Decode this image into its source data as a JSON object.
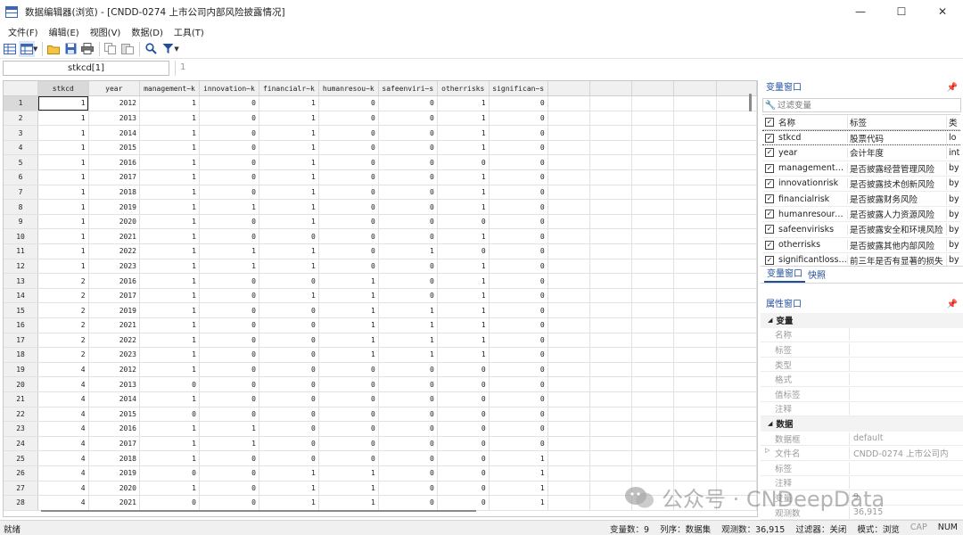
{
  "window": {
    "title": "数据编辑器(浏览) - [CNDD-0274 上市公司内部风险披露情况]",
    "controls": [
      "—",
      "☐",
      "✕"
    ]
  },
  "menu": [
    "文件(F)",
    "编辑(E)",
    "视图(V)",
    "数据(D)",
    "工具(T)"
  ],
  "toolbar": {
    "icons": [
      "data-editor-icon",
      "table-view-icon",
      "open-icon",
      "save-icon",
      "print-icon",
      "copy-icon",
      "paste-icon",
      "search-icon",
      "filter-icon"
    ]
  },
  "refbar": {
    "cell_ref": "stkcd[1]",
    "cell_value": "1"
  },
  "grid": {
    "columns": [
      "stkcd",
      "year",
      "management~k",
      "innovation~k",
      "financialr~k",
      "humanresou~k",
      "safeenviri~s",
      "otherrisks",
      "significan~s"
    ],
    "rows": [
      [
        "1",
        "1",
        "2012",
        "1",
        "0",
        "1",
        "0",
        "0",
        "1",
        "0"
      ],
      [
        "2",
        "1",
        "2013",
        "1",
        "0",
        "1",
        "0",
        "0",
        "1",
        "0"
      ],
      [
        "3",
        "1",
        "2014",
        "1",
        "0",
        "1",
        "0",
        "0",
        "1",
        "0"
      ],
      [
        "4",
        "1",
        "2015",
        "1",
        "0",
        "1",
        "0",
        "0",
        "1",
        "0"
      ],
      [
        "5",
        "1",
        "2016",
        "1",
        "0",
        "1",
        "0",
        "0",
        "0",
        "0"
      ],
      [
        "6",
        "1",
        "2017",
        "1",
        "0",
        "1",
        "0",
        "0",
        "1",
        "0"
      ],
      [
        "7",
        "1",
        "2018",
        "1",
        "0",
        "1",
        "0",
        "0",
        "1",
        "0"
      ],
      [
        "8",
        "1",
        "2019",
        "1",
        "1",
        "1",
        "0",
        "0",
        "1",
        "0"
      ],
      [
        "9",
        "1",
        "2020",
        "1",
        "0",
        "1",
        "0",
        "0",
        "0",
        "0"
      ],
      [
        "10",
        "1",
        "2021",
        "1",
        "0",
        "0",
        "0",
        "0",
        "1",
        "0"
      ],
      [
        "11",
        "1",
        "2022",
        "1",
        "1",
        "1",
        "0",
        "1",
        "0",
        "0"
      ],
      [
        "12",
        "1",
        "2023",
        "1",
        "1",
        "1",
        "0",
        "0",
        "1",
        "0"
      ],
      [
        "13",
        "2",
        "2016",
        "1",
        "0",
        "0",
        "1",
        "0",
        "1",
        "0"
      ],
      [
        "14",
        "2",
        "2017",
        "1",
        "0",
        "1",
        "1",
        "0",
        "1",
        "0"
      ],
      [
        "15",
        "2",
        "2019",
        "1",
        "0",
        "0",
        "1",
        "1",
        "1",
        "0"
      ],
      [
        "16",
        "2",
        "2021",
        "1",
        "0",
        "0",
        "1",
        "1",
        "1",
        "0"
      ],
      [
        "17",
        "2",
        "2022",
        "1",
        "0",
        "0",
        "1",
        "1",
        "1",
        "0"
      ],
      [
        "18",
        "2",
        "2023",
        "1",
        "0",
        "0",
        "1",
        "1",
        "1",
        "0"
      ],
      [
        "19",
        "4",
        "2012",
        "1",
        "0",
        "0",
        "0",
        "0",
        "0",
        "0"
      ],
      [
        "20",
        "4",
        "2013",
        "0",
        "0",
        "0",
        "0",
        "0",
        "0",
        "0"
      ],
      [
        "21",
        "4",
        "2014",
        "1",
        "0",
        "0",
        "0",
        "0",
        "0",
        "0"
      ],
      [
        "22",
        "4",
        "2015",
        "0",
        "0",
        "0",
        "0",
        "0",
        "0",
        "0"
      ],
      [
        "23",
        "4",
        "2016",
        "1",
        "1",
        "0",
        "0",
        "0",
        "0",
        "0"
      ],
      [
        "24",
        "4",
        "2017",
        "1",
        "1",
        "0",
        "0",
        "0",
        "0",
        "0"
      ],
      [
        "25",
        "4",
        "2018",
        "1",
        "0",
        "0",
        "0",
        "0",
        "0",
        "1"
      ],
      [
        "26",
        "4",
        "2019",
        "0",
        "0",
        "1",
        "1",
        "0",
        "0",
        "1"
      ],
      [
        "27",
        "4",
        "2020",
        "1",
        "0",
        "1",
        "1",
        "0",
        "0",
        "1"
      ],
      [
        "28",
        "4",
        "2021",
        "0",
        "0",
        "1",
        "1",
        "0",
        "0",
        "1"
      ]
    ]
  },
  "variables_panel": {
    "title": "变量窗口",
    "filter_placeholder": "过滤变量",
    "headers": {
      "name": "名称",
      "label": "标签",
      "type": "类"
    },
    "items": [
      {
        "name": "stkcd",
        "label": "股票代码",
        "type": "lo"
      },
      {
        "name": "year",
        "label": "会计年度",
        "type": "int"
      },
      {
        "name": "managementri...",
        "label": "是否披露经营管理风险",
        "type": "by"
      },
      {
        "name": "innovationrisk",
        "label": "是否披露技术创新风险",
        "type": "by"
      },
      {
        "name": "financialrisk",
        "label": "是否披露财务风险",
        "type": "by"
      },
      {
        "name": "humanresourc...",
        "label": "是否披露人力资源风险",
        "type": "by"
      },
      {
        "name": "safeenvirisks",
        "label": "是否披露安全和环境风险",
        "type": "by"
      },
      {
        "name": "otherrisks",
        "label": "是否披露其他内部风险",
        "type": "by"
      },
      {
        "name": "significantlosses",
        "label": "前三年是否有显著的损失",
        "type": "by"
      }
    ],
    "tabs": [
      "变量窗口",
      "快照"
    ]
  },
  "properties_panel": {
    "title": "属性窗口",
    "sections": [
      {
        "name": "变量",
        "rows": [
          {
            "key": "名称",
            "value": ""
          },
          {
            "key": "标签",
            "value": ""
          },
          {
            "key": "类型",
            "value": ""
          },
          {
            "key": "格式",
            "value": ""
          },
          {
            "key": "值标签",
            "value": ""
          },
          {
            "key": "注释",
            "value": ""
          }
        ]
      },
      {
        "name": "数据",
        "rows": [
          {
            "key": "数据框",
            "value": "default"
          },
          {
            "key": "文件名",
            "value": "CNDD-0274 上市公司内"
          },
          {
            "key": "标签",
            "value": ""
          },
          {
            "key": "注释",
            "value": ""
          },
          {
            "key": "变量",
            "value": "9"
          },
          {
            "key": "观测数",
            "value": "36,915"
          }
        ]
      }
    ]
  },
  "status": {
    "left": "就绪",
    "vars": "变量数：9",
    "order": "列序：数据集",
    "obs": "观测数：36,915",
    "filter": "过滤器：关闭",
    "mode": "模式：浏览",
    "cap": "CAP",
    "num": "NUM"
  },
  "watermark": {
    "text": "公众号 · CNDeepData"
  },
  "colors": {
    "accent": "#1f4e9c",
    "header_bg": "#f0f0f0",
    "selected_header": "#d9d9d9"
  }
}
